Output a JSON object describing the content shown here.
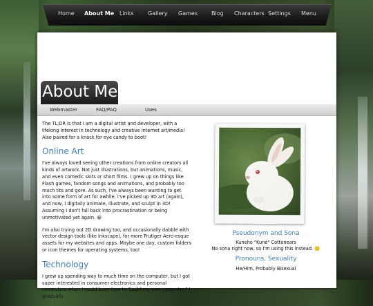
{
  "nav": {
    "items": [
      {
        "label": "Home"
      },
      {
        "label": "About Me",
        "active": true
      },
      {
        "label": "Links"
      },
      {
        "label": "Gallery"
      },
      {
        "label": "Games"
      },
      {
        "label": "Blog"
      },
      {
        "label": "Characters"
      },
      {
        "label": "Settings"
      },
      {
        "label": "Menu"
      }
    ]
  },
  "page": {
    "title": "About Me",
    "subnav": [
      {
        "label": "Webmaster"
      },
      {
        "label": "FAQ/PAQ"
      },
      {
        "label": "Uses"
      }
    ]
  },
  "main": {
    "intro": "The TL;DR is that I am a digital artist and developer, with a lifelong interest in technology and creative internet art/media! Also paired for a knack for eye candy to boot!",
    "online_art": {
      "heading": "Online Art",
      "p1": "I've always loved seeing other creations from online creators all kinds of artwork. Not just illustrations, but animations, music, and even comedic skits or short films. I grew up on things like Flash games, fandom songs and animations, and probably too much tits and gore. As such, I've always been wanting to get into some form of art for awhile. I've picked up 3D art (again), and now, I digitally animate, illustrate, and sculpt in 3D! Assuming I don't fall back into procrastination or being unmotivated yet again. 😀",
      "p2": "I'm also trying out 2D drawing too, and occasionally dabble with vector design tools (like Inkscape), for more Frutiger Aero-esque assets for my websites and apps. Maybe one day, custom folders or icon themes for operating systems, too!"
    },
    "technology": {
      "heading": "Technology",
      "p1": "I grew up spending way to much time on the computer, but I got super interested in consumer electronics and personal computers when I could learn how to \"build my own computer.\" I gradually"
    }
  },
  "sidebar": {
    "photo_alt": "white rabbit",
    "pseudonym_heading": "Pseudonym and Sona",
    "pseudonym_line1": "Kuneho \"Kuné\" Cottonears",
    "pseudonym_line2": "No sona right now, so I'm using this instead. 🙂",
    "pronouns_heading": "Pronouns, Sexuality",
    "pronouns_line1": "He/Him, Probably Bisexual"
  },
  "colors": {
    "accent": "#3f7fbf",
    "nav_bg": "#1b1b1b"
  }
}
